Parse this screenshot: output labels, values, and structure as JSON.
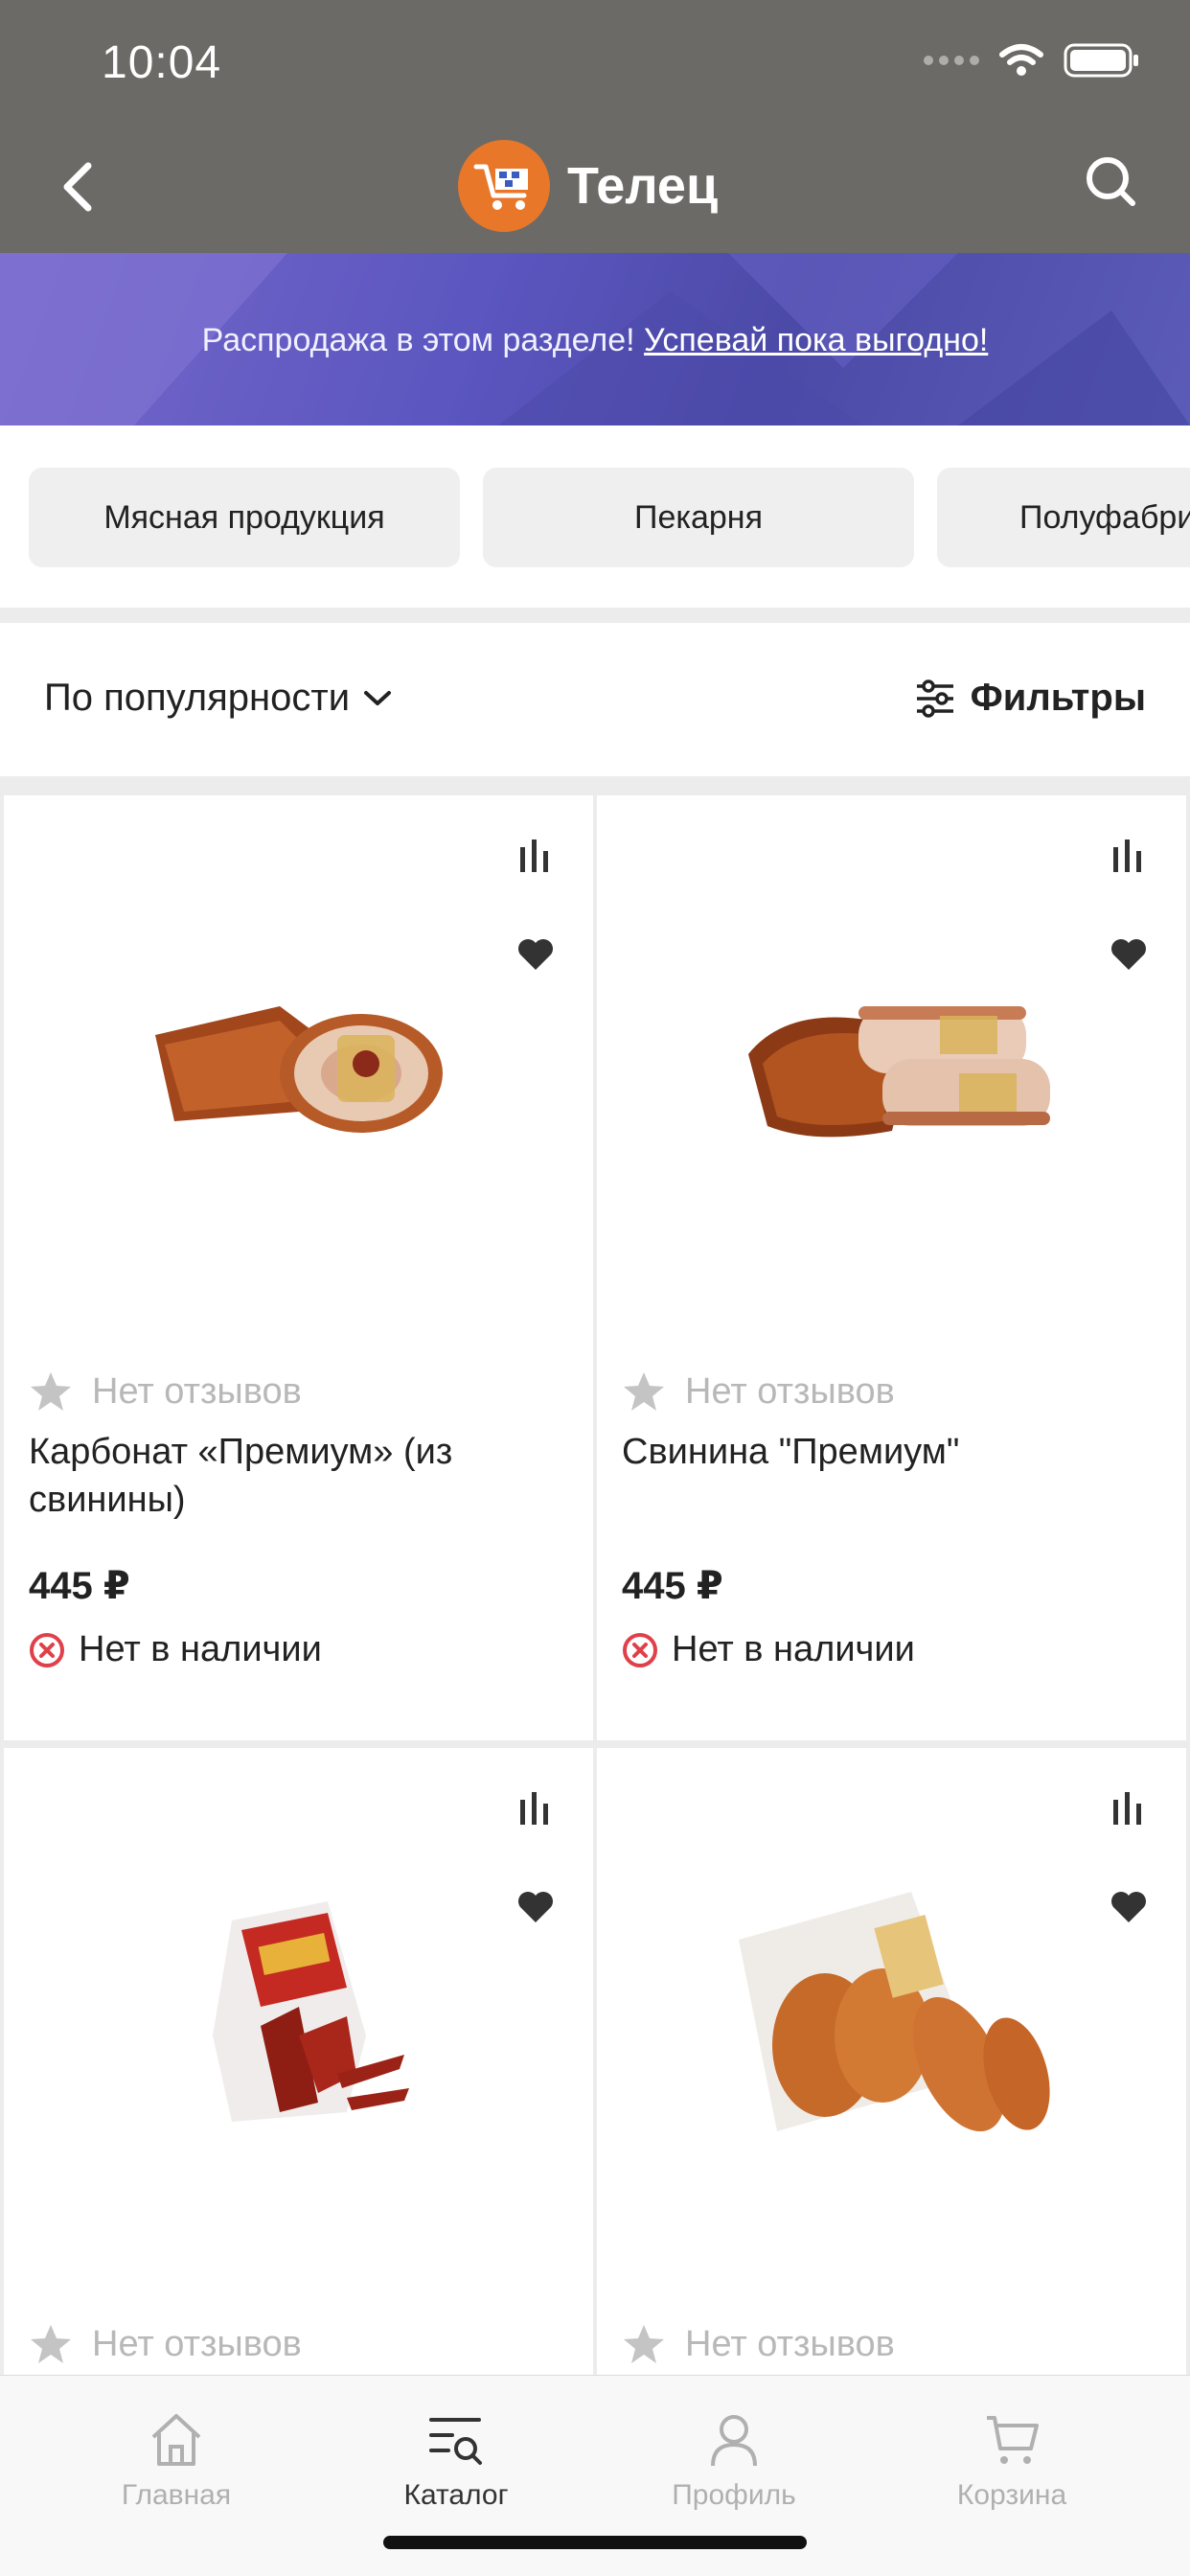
{
  "status": {
    "time": "10:04"
  },
  "nav": {
    "title": "Телец"
  },
  "banner": {
    "text": "Распродажа в этом разделе!",
    "link": "Успевай пока выгодно!"
  },
  "categories": [
    "Мясная продукция",
    "Пекарня",
    "Полуфабрикаты"
  ],
  "sort": {
    "label": "По популярности"
  },
  "filters": {
    "label": "Фильтры"
  },
  "products": [
    {
      "reviews": "Нет отзывов",
      "name": "Карбонат «Премиум» (из свинины)",
      "price": "445 ₽",
      "stock": "Нет в наличии"
    },
    {
      "reviews": "Нет отзывов",
      "name": "Свинина \"Премиум\"",
      "price": "445 ₽",
      "stock": "Нет в наличии"
    },
    {
      "reviews": "Нет отзывов",
      "name": "",
      "price": "",
      "stock": ""
    },
    {
      "reviews": "Нет отзывов",
      "name": "",
      "price": "",
      "stock": ""
    }
  ],
  "tabs": [
    {
      "label": "Главная",
      "icon": "home-icon"
    },
    {
      "label": "Каталог",
      "icon": "catalog-icon",
      "active": true
    },
    {
      "label": "Профиль",
      "icon": "profile-icon"
    },
    {
      "label": "Корзина",
      "icon": "cart-icon"
    }
  ],
  "colors": {
    "topbar": "#6b6a66",
    "banner": "#5b56c0",
    "out_of_stock": "#e0404a",
    "brand": "#e8772a"
  }
}
